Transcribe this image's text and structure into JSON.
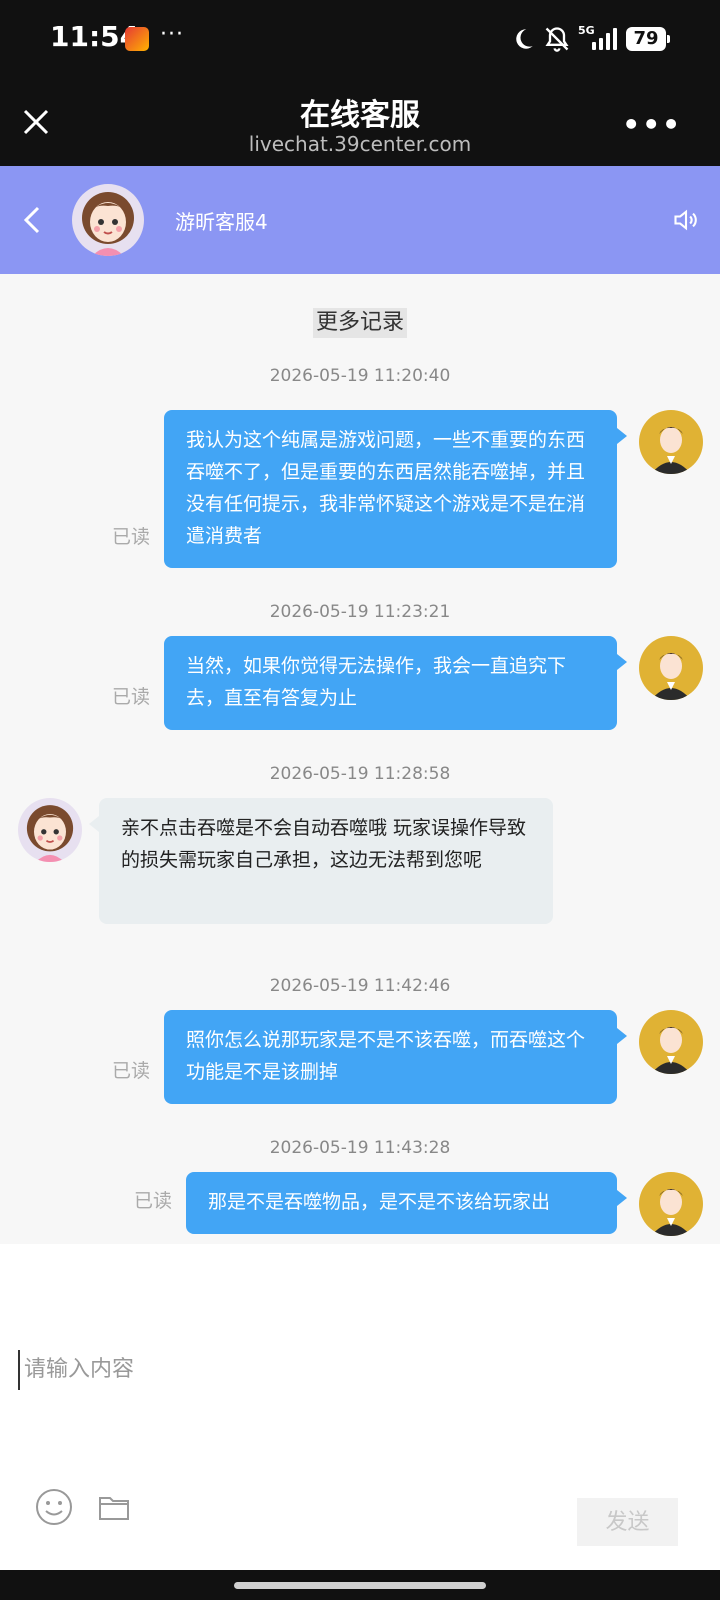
{
  "status_bar": {
    "time": "11:54",
    "more": "···",
    "network": "5G",
    "battery": "79"
  },
  "browser": {
    "title": "在线客服",
    "url": "livechat.39center.com"
  },
  "chat_header": {
    "agent_name": "游昕客服4"
  },
  "history_link": "更多记录",
  "messages": [
    {
      "time": "2026-05-19 11:20:40",
      "sender": "user",
      "text": "我认为这个纯属是游戏问题，一些不重要的东西吞噬不了，但是重要的东西居然能吞噬掉，并且没有任何提示，我非常怀疑这个游戏是不是在消遣消费者",
      "status": "已读"
    },
    {
      "time": "2026-05-19 11:23:21",
      "sender": "user",
      "text": "当然，如果你觉得无法操作，我会一直追究下去，直至有答复为止",
      "status": "已读"
    },
    {
      "time": "2026-05-19 11:28:58",
      "sender": "agent",
      "text": "亲不点击吞噬是不会自动吞噬哦 玩家误操作导致的损失需玩家自己承担，这边无法帮到您呢"
    },
    {
      "time": "2026-05-19 11:42:46",
      "sender": "user",
      "text": "照你怎么说那玩家是不是不该吞噬，而吞噬这个功能是不是该删掉",
      "status": "已读"
    },
    {
      "time": "2026-05-19 11:43:28",
      "sender": "user",
      "text": "那是不是吞噬物品，是不是不该给玩家出",
      "status": "已读"
    }
  ],
  "input": {
    "placeholder": "请输入内容",
    "send_label": "发送"
  },
  "colors": {
    "header_bg": "#8b96f3",
    "user_bubble": "#42a5f5",
    "agent_bubble": "#e9eef0",
    "user_avatar_bg": "#e0b234"
  }
}
